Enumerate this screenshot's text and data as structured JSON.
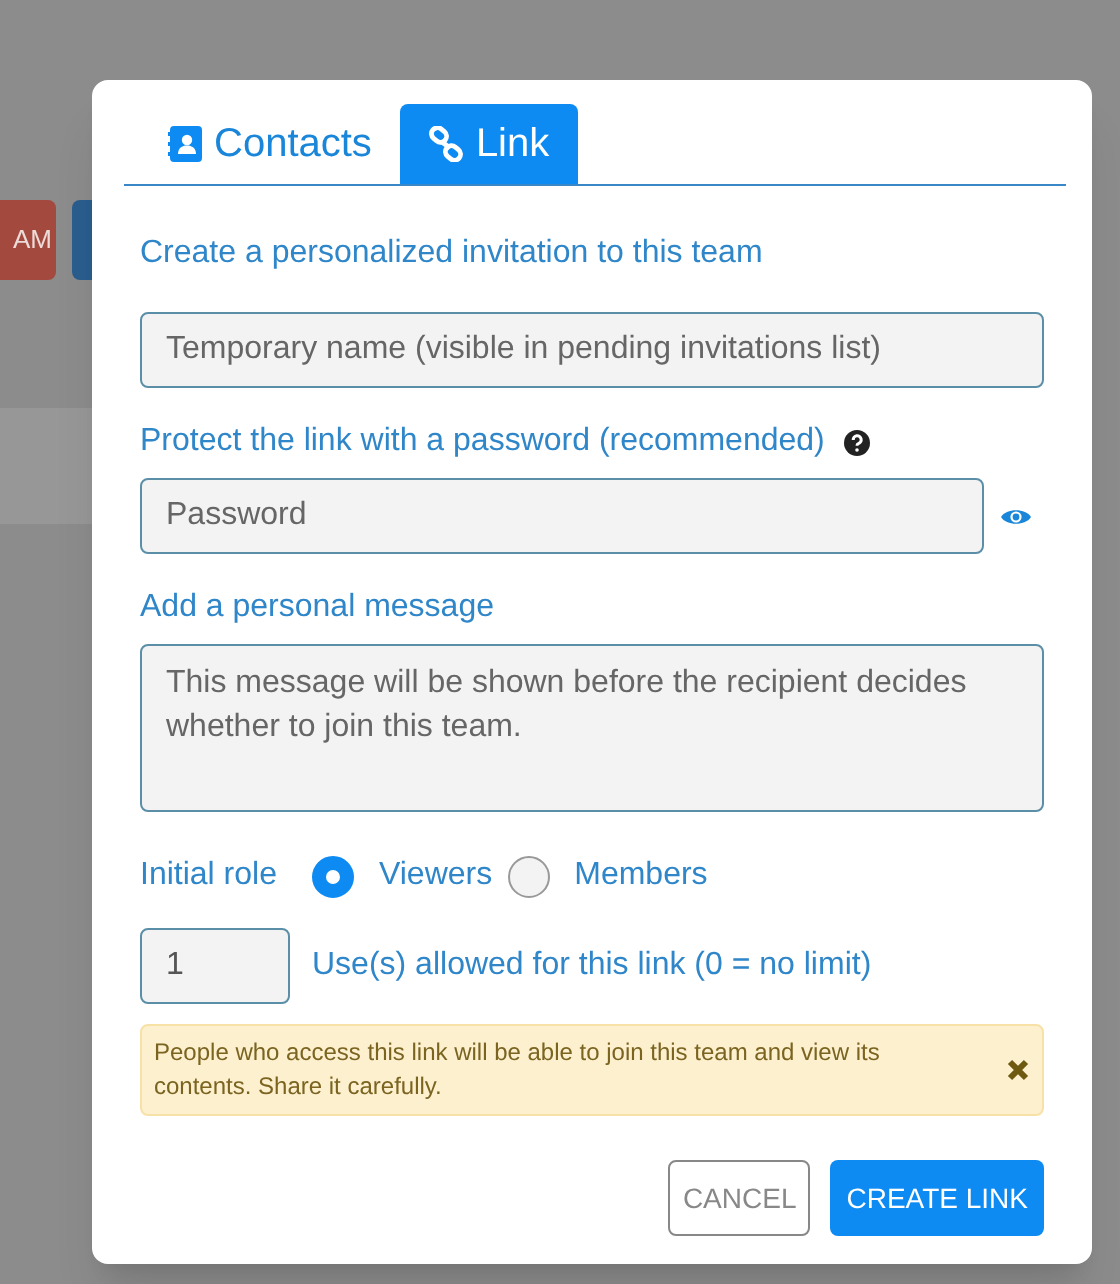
{
  "background": {
    "button_label": "AM"
  },
  "tabs": [
    {
      "label": "Contacts",
      "selected": false
    },
    {
      "label": "Link",
      "selected": true
    }
  ],
  "form": {
    "intro": "Create a personalized invitation to this team",
    "name_field": {
      "placeholder": "Temporary name (visible in pending invitations list)"
    },
    "password_label": "Protect the link with a password (recommended)",
    "password_field": {
      "placeholder": "Password"
    },
    "message_label": "Add a personal message",
    "message_field": {
      "placeholder": "This message will be shown before the recipient decides whether to join this team."
    },
    "role_label": "Initial role",
    "roles": [
      {
        "label": "Viewers",
        "selected": true
      },
      {
        "label": "Members",
        "selected": false
      }
    ],
    "uses_field": {
      "value": "1"
    },
    "uses_label": "Use(s) allowed for this link (0 = no limit)",
    "warning": "People who access this link will be able to join this team and view its contents. Share it carefully."
  },
  "buttons": [
    {
      "label": "CANCEL",
      "kind": "secondary"
    },
    {
      "label": "CREATE LINK",
      "kind": "primary"
    }
  ]
}
